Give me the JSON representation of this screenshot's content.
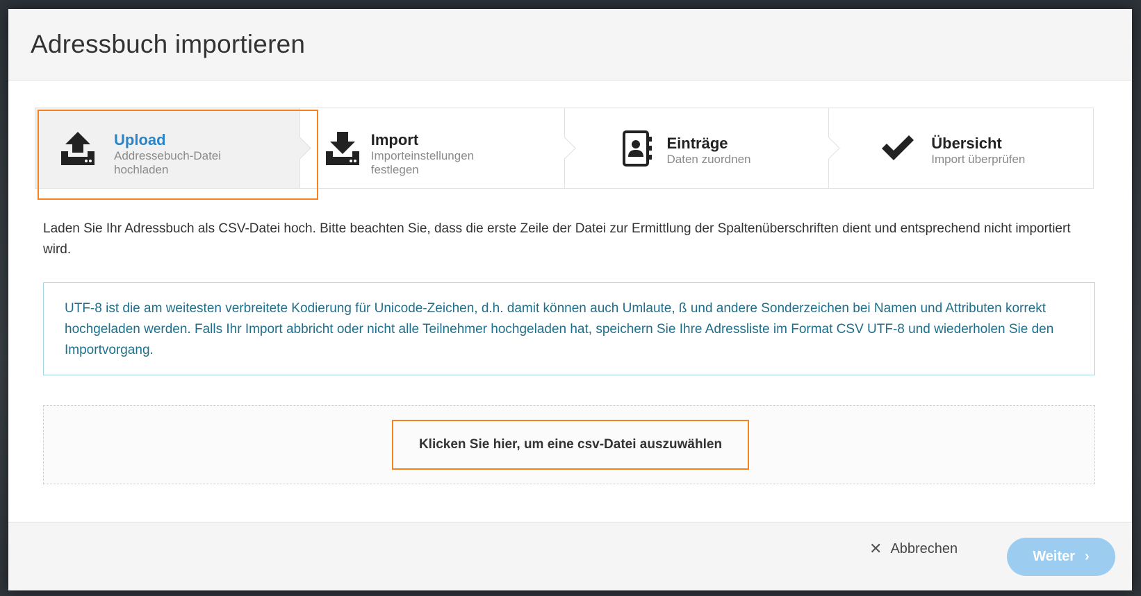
{
  "modal": {
    "title": "Adressbuch importieren"
  },
  "steps": [
    {
      "title": "Upload",
      "subtitle": "Addressebuch-Datei hochladen",
      "icon": "upload-icon",
      "active": true
    },
    {
      "title": "Import",
      "subtitle": "Importeinstellungen festlegen",
      "icon": "download-icon",
      "active": false
    },
    {
      "title": "Einträge",
      "subtitle": "Daten zuordnen",
      "icon": "address-book-icon",
      "active": false
    },
    {
      "title": "Übersicht",
      "subtitle": "Import überprüfen",
      "icon": "checkmark-icon",
      "active": false
    }
  ],
  "content": {
    "intro": "Laden Sie Ihr Adressbuch als CSV-Datei hoch. Bitte beachten Sie, dass die erste Zeile der Datei zur Ermittlung der Spaltenüberschriften dient und entsprechend nicht importiert wird.",
    "info": "UTF-8 ist die am weitesten verbreitete Kodierung für Unicode-Zeichen, d.h. damit können auch Umlaute, ß und andere Sonderzeichen bei Namen und Attributen korrekt hochgeladen werden. Falls Ihr Import abbricht oder nicht alle Teilnehmer hochgeladen hat, speichern Sie Ihre Adressliste im Format CSV UTF-8 und wiederholen Sie den Importvorgang.",
    "dropzone_label": "Klicken Sie hier, um eine csv-Datei auszuwählen"
  },
  "footer": {
    "cancel_label": "Abbrechen",
    "next_label": "Weiter"
  },
  "colors": {
    "accent": "#2a86c8",
    "highlight": "#f5821f",
    "info_text": "#1f6f8b",
    "next_button": "#9ccdf0"
  }
}
